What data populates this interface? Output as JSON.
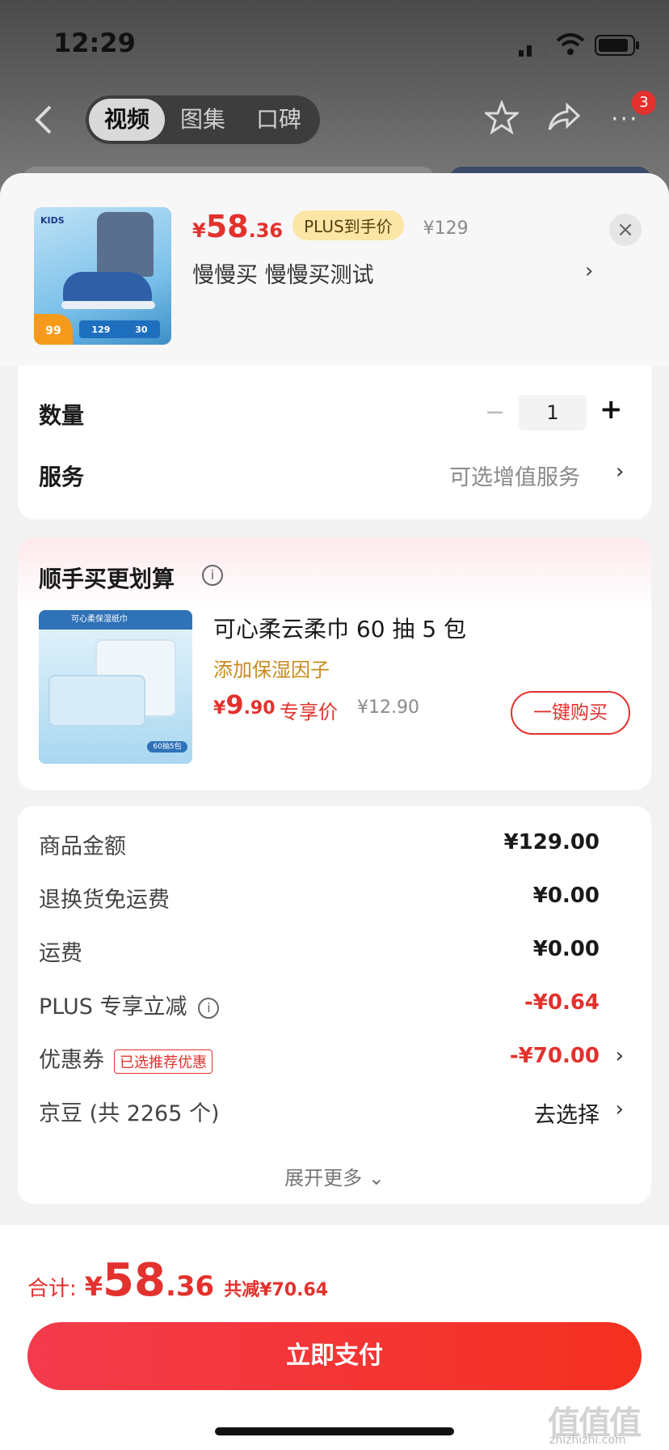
{
  "status_bar": {
    "time": "12:29"
  },
  "nav": {
    "tabs": [
      {
        "label": "视频",
        "active": true
      },
      {
        "label": "图集",
        "active": false
      },
      {
        "label": "口碑",
        "active": false
      }
    ],
    "badge_count": "3",
    "more_glyph": "···"
  },
  "product": {
    "price_symbol": "¥",
    "price_int": "58",
    "price_dec": ".36",
    "plus_tag": "PLUS到手价",
    "original_price": "¥129",
    "spec": "慢慢买  慢慢买测试",
    "image_texts": {
      "brand": "KIDS",
      "badge": "99",
      "n1": "129",
      "n2": "30"
    },
    "close_glyph": "×",
    "spec_arrow": "›"
  },
  "options": {
    "quantity_label": "数量",
    "quantity_value": "1",
    "minus_glyph": "−",
    "plus_glyph": "+",
    "service_label": "服务",
    "service_value": "可选增值服务",
    "service_arrow": "›"
  },
  "recommend": {
    "title": "顺手买更划算",
    "info_glyph": "i",
    "item_name": "可心柔云柔巾 60 抽 5 包",
    "item_sub": "添加保湿因子",
    "price_symbol": "¥",
    "price_int": "9",
    "price_dec": ".90",
    "exclusive": "专享价",
    "old_price": "¥12.90",
    "buy_button": "一键购买",
    "image_texts": {
      "header": "可心柔保湿纸巾",
      "tag": "60抽5包"
    }
  },
  "fees": [
    {
      "label": "商品金额",
      "value": "¥129.00",
      "style": "bold"
    },
    {
      "label": "退换货免运费",
      "value": "¥0.00",
      "style": "bold"
    },
    {
      "label": "运费",
      "value": "¥0.00",
      "style": "bold"
    },
    {
      "label": "PLUS 专享立减",
      "value": "-¥0.64",
      "style": "red",
      "info": true
    },
    {
      "label": "优惠券",
      "value": "-¥70.00",
      "style": "red",
      "tag": "已选推荐优惠",
      "arrow": true
    },
    {
      "label": "京豆 (共 2265 个)",
      "value": "去选择",
      "style": "plain",
      "arrow": true
    }
  ],
  "expand_more": "展开更多 ⌄",
  "footer": {
    "total_label": "合计:",
    "price_symbol": "¥",
    "price_int": "58",
    "price_dec": ".36",
    "saved": "共减¥70.64",
    "pay_button": "立即支付"
  },
  "watermark": {
    "mark": "值值值",
    "site": "zhizhizhi.com"
  },
  "colors": {
    "accent": "#e3312d",
    "plus_tag_bg": "#fbe6a6",
    "sub_text": "#c88a1c"
  }
}
